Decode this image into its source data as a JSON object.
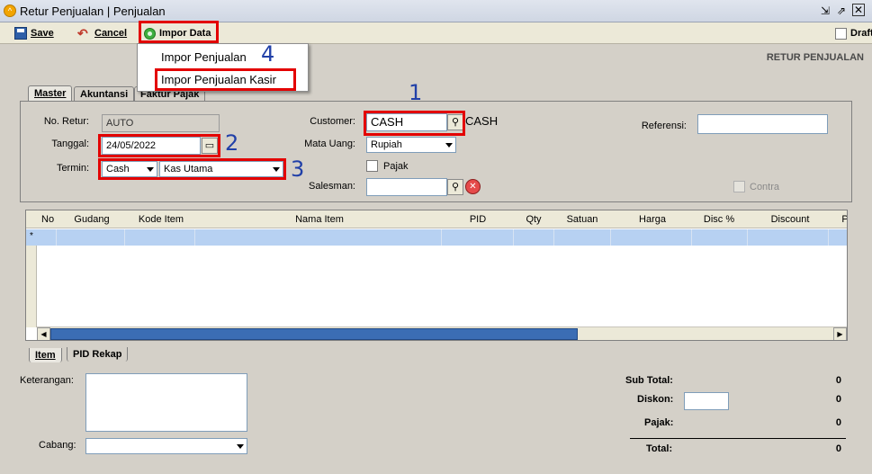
{
  "window": {
    "title": "Retur Penjualan | Penjualan"
  },
  "toolbar": {
    "save_label": "Save",
    "cancel_label": "Cancel",
    "impor_label": "Impor Data",
    "draft_label": "Draft"
  },
  "impor_menu": {
    "items": [
      "Impor Penjualan",
      "Impor Penjualan Kasir"
    ]
  },
  "form": {
    "heading": "RETUR PENJUALAN",
    "tabs": [
      "Master",
      "Akuntansi",
      "Faktur Pajak"
    ],
    "no_retur_label": "No. Retur:",
    "no_retur_value": "AUTO",
    "tanggal_label": "Tanggal:",
    "tanggal_value": "24/05/2022",
    "termin_label": "Termin:",
    "termin_value": "Cash",
    "kas_value": "Kas Utama",
    "customer_label": "Customer:",
    "customer_value": "CASH",
    "customer_name": "CASH",
    "mata_uang_label": "Mata Uang:",
    "mata_uang_value": "Rupiah",
    "pajak_label": "Pajak",
    "salesman_label": "Salesman:",
    "salesman_value": "",
    "referensi_label": "Referensi:",
    "referensi_value": "",
    "contra_label": "Contra"
  },
  "annotations": [
    "1",
    "2",
    "3",
    "4"
  ],
  "grid": {
    "columns": [
      "No",
      "Gudang",
      "Kode Item",
      "Nama Item",
      "PID",
      "Qty",
      "Satuan",
      "Harga",
      "Disc %",
      "Discount",
      "P"
    ],
    "new_row_marker": "*"
  },
  "bottom_tabs": [
    "Item",
    "PID Rekap"
  ],
  "footer": {
    "keterangan_label": "Keterangan:",
    "cabang_label": "Cabang:",
    "cabang_value": "",
    "sub_total_label": "Sub Total:",
    "sub_total_value": "0",
    "diskon_label": "Diskon:",
    "diskon_input": "",
    "diskon_value": "0",
    "pajak_label": "Pajak:",
    "pajak_value": "0",
    "total_label": "Total:",
    "total_value": "0"
  },
  "colors": {
    "highlight_box": "#e30000",
    "annotation_text": "#2140a8",
    "selected_row": "#b7d1f2",
    "scroll_thumb": "#3b6db4"
  },
  "icons": [
    "app-icon",
    "minimize-restore-icon",
    "maximize-icon",
    "close-icon",
    "save-icon",
    "cancel-icon",
    "impor-icon",
    "lookup-icon",
    "clear-icon",
    "calendar-icon"
  ]
}
